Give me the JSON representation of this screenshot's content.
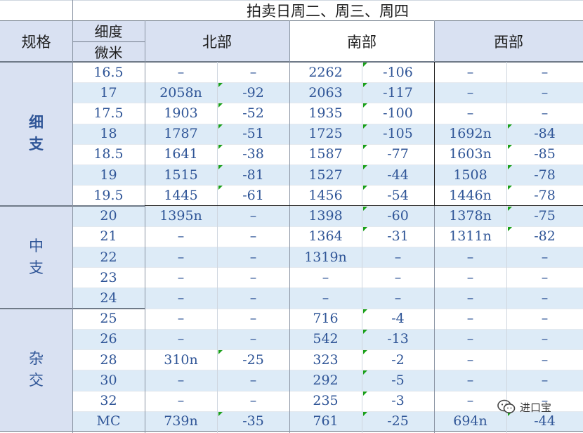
{
  "title": "拍卖日周二、周三、周四",
  "header": {
    "spec": "规格",
    "fineness_line1": "细度",
    "fineness_line2": "微米",
    "regions": [
      "北部",
      "南部",
      "西部"
    ]
  },
  "groups": [
    {
      "chars": [
        "细",
        "支"
      ],
      "bold": true
    },
    {
      "chars": [
        "中",
        "支"
      ],
      "bold": false
    },
    {
      "chars": [
        "杂",
        "交"
      ],
      "bold": false
    }
  ],
  "rows": [
    [
      "16.5",
      "–",
      "–",
      "2262",
      "-106",
      "–",
      "–"
    ],
    [
      "17",
      "2058n",
      "-92",
      "2063",
      "-117",
      "–",
      "–"
    ],
    [
      "17.5",
      "1903",
      "-52",
      "1935",
      "-100",
      "–",
      "–"
    ],
    [
      "18",
      "1787",
      "-51",
      "1725",
      "-105",
      "1692n",
      "-84"
    ],
    [
      "18.5",
      "1641",
      "-38",
      "1587",
      "-77",
      "1603n",
      "-85"
    ],
    [
      "19",
      "1515",
      "-81",
      "1527",
      "-44",
      "1508",
      "-78"
    ],
    [
      "19.5",
      "1445",
      "-61",
      "1456",
      "-54",
      "1446n",
      "-78"
    ],
    [
      "20",
      "1395n",
      "–",
      "1398",
      "-60",
      "1378n",
      "-75"
    ],
    [
      "21",
      "–",
      "–",
      "1364",
      "-31",
      "1311n",
      "-82"
    ],
    [
      "22",
      "–",
      "–",
      "1319n",
      "–",
      "–",
      "–"
    ],
    [
      "23",
      "–",
      "–",
      "–",
      "–",
      "–",
      "–"
    ],
    [
      "24",
      "–",
      "–",
      "–",
      "–",
      "–",
      "–"
    ],
    [
      "25",
      "–",
      "–",
      "716",
      "-4",
      "–",
      "–"
    ],
    [
      "26",
      "–",
      "–",
      "542",
      "-13",
      "–",
      "–"
    ],
    [
      "28",
      "310n",
      "-25",
      "323",
      "-2",
      "–",
      "–"
    ],
    [
      "30",
      "–",
      "–",
      "292",
      "-5",
      "–",
      "–"
    ],
    [
      "32",
      "–",
      "–",
      "235",
      "-3",
      "–",
      "–"
    ],
    [
      "MC",
      "739n",
      "-35",
      "761",
      "-25",
      "694n",
      "-44"
    ]
  ],
  "watermark": {
    "icon": "wechat-icon",
    "text": "进口宝"
  },
  "colors": {
    "header_bg": "#d9e1f2",
    "stripe": "#ddebf7",
    "grid": "#c8cfd9",
    "text": "#2f5597"
  }
}
